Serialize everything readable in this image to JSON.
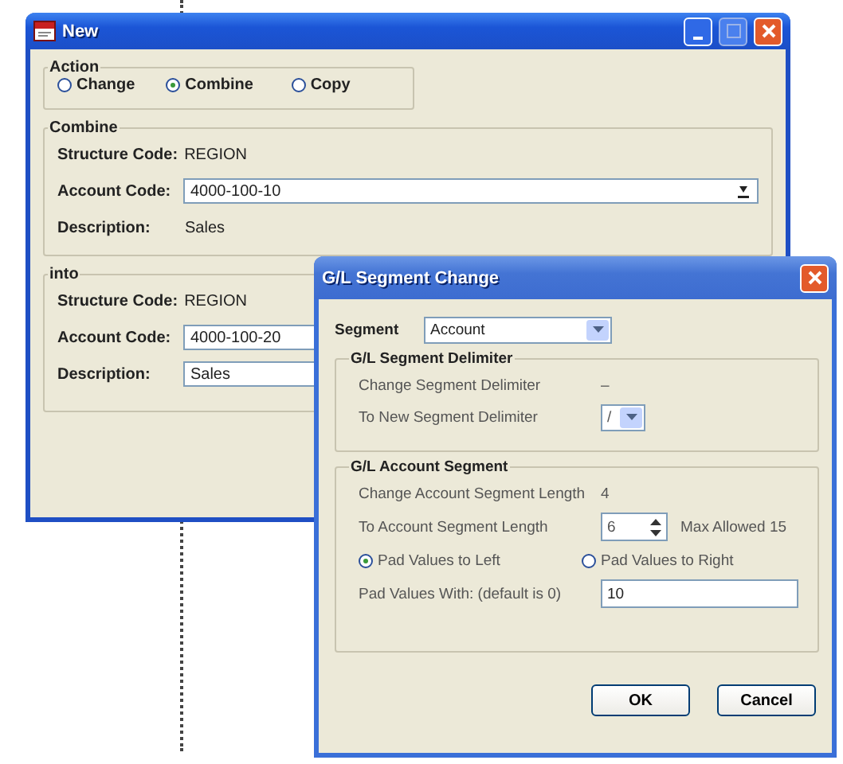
{
  "new_window": {
    "title": "New",
    "action": {
      "label": "Action",
      "options": [
        {
          "label": "Change",
          "selected": false
        },
        {
          "label": "Combine",
          "selected": true
        },
        {
          "label": "Copy",
          "selected": false
        }
      ]
    },
    "combine": {
      "label": "Combine",
      "structure_code_label": "Structure Code:",
      "structure_code": "REGION",
      "account_code_label": "Account Code:",
      "account_code": "4000-100-10",
      "description_label": "Description:",
      "description": "Sales"
    },
    "into": {
      "label": "into",
      "structure_code_label": "Structure Code:",
      "structure_code": "REGION",
      "account_code_label": "Account Code:",
      "account_code": "4000-100-20",
      "description_label": "Description:",
      "description": "Sales"
    }
  },
  "segment_dialog": {
    "title": "G/L Segment Change",
    "segment_label": "Segment",
    "segment": "Account",
    "delimiter_group": {
      "label": "G/L Segment Delimiter",
      "change_label": "Change Segment Delimiter",
      "change_value": "–",
      "new_label": "To New Segment Delimiter",
      "new_value": "/"
    },
    "account_group": {
      "label": "G/L Account Segment",
      "change_length_label": "Change Account Segment Length",
      "change_length": "4",
      "new_length_label": "To Account Segment Length",
      "new_length": "6",
      "max_allowed": "Max Allowed 15",
      "pad_options": [
        {
          "label": "Pad Values to Left",
          "selected": true
        },
        {
          "label": "Pad Values to Right",
          "selected": false
        }
      ],
      "pad_with_label": "Pad Values With: (default is 0)",
      "pad_with": "10"
    },
    "buttons": [
      "OK",
      "Cancel"
    ]
  }
}
